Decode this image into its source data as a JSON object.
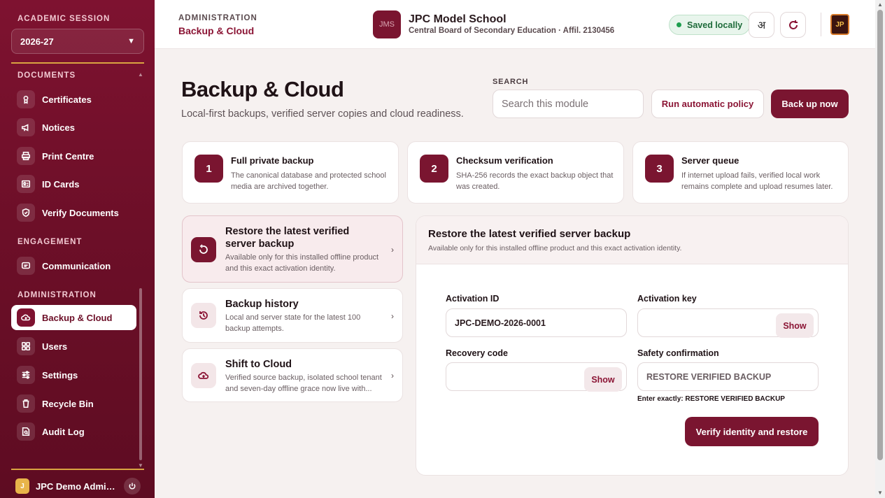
{
  "sidebar": {
    "session_label": "ACADEMIC SESSION",
    "session_value": "2026-27",
    "documents_label": "DOCUMENTS",
    "engagement_label": "ENGAGEMENT",
    "administration_label": "ADMINISTRATION",
    "items": [
      {
        "label": "Certificates",
        "icon": "certificate-icon"
      },
      {
        "label": "Notices",
        "icon": "megaphone-icon"
      },
      {
        "label": "Print Centre",
        "icon": "printer-icon"
      },
      {
        "label": "ID Cards",
        "icon": "id-card-icon"
      },
      {
        "label": "Verify Documents",
        "icon": "shield-check-icon"
      },
      {
        "label": "Communication",
        "icon": "chat-icon"
      },
      {
        "label": "Backup & Cloud",
        "icon": "cloud-upload-icon",
        "active": true
      },
      {
        "label": "Users",
        "icon": "grid-icon"
      },
      {
        "label": "Settings",
        "icon": "sliders-icon"
      },
      {
        "label": "Recycle Bin",
        "icon": "trash-icon"
      },
      {
        "label": "Audit Log",
        "icon": "log-search-icon"
      }
    ],
    "user_initial": "J",
    "user_name": "JPC Demo Administrator"
  },
  "header": {
    "crumb_top": "ADMINISTRATION",
    "crumb_main": "Backup & Cloud",
    "school_logo": "JMS",
    "school_name": "JPC Model School",
    "school_sub": "Central Board of Secondary Education · Affil. 2130456",
    "saved_status": "Saved locally",
    "lang_toggle": "अ",
    "brand_logo": "JP"
  },
  "main": {
    "title": "Backup & Cloud",
    "subtitle": "Local-first backups, verified server copies and cloud readiness.",
    "search_label": "SEARCH",
    "search_placeholder": "Search this module",
    "run_policy_label": "Run automatic policy",
    "backup_now_label": "Back up now",
    "steps": [
      {
        "num": "1",
        "title": "Full private backup",
        "desc": "The canonical database and protected school media are archived together."
      },
      {
        "num": "2",
        "title": "Checksum verification",
        "desc": "SHA-256 records the exact backup object that was created."
      },
      {
        "num": "3",
        "title": "Server queue",
        "desc": "If internet upload fails, verified local work remains complete and upload resumes later."
      }
    ],
    "nav_cards": [
      {
        "title": "Restore the latest verified server backup",
        "desc": "Available only for this installed offline product and this exact activation identity."
      },
      {
        "title": "Backup history",
        "desc": "Local and server state for the latest 100 backup attempts."
      },
      {
        "title": "Shift to Cloud",
        "desc": "Verified source backup, isolated school tenant and seven-day offline grace now live with..."
      }
    ]
  },
  "panel": {
    "title": "Restore the latest verified server backup",
    "desc": "Available only for this installed offline product and this exact activation identity.",
    "activation_id_label": "Activation ID",
    "activation_id_value": "JPC-DEMO-2026-0001",
    "activation_key_label": "Activation key",
    "recovery_code_label": "Recovery code",
    "safety_label": "Safety confirmation",
    "safety_placeholder": "RESTORE VERIFIED BACKUP",
    "show_label": "Show",
    "hint": "Enter exactly: RESTORE VERIFIED BACKUP",
    "restore_label": "Verify identity and restore"
  }
}
